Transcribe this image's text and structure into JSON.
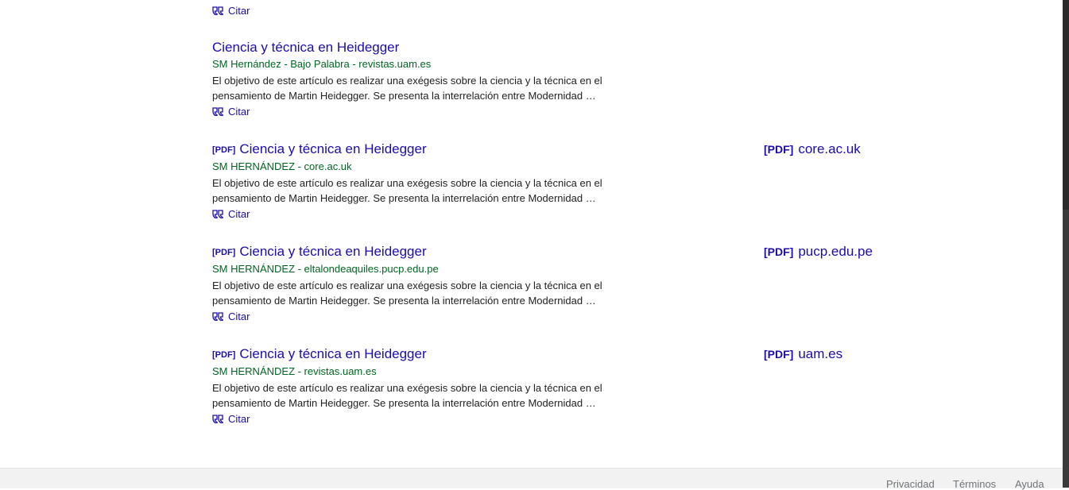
{
  "cite_label": "Citar",
  "top_cite": {
    "label": "Citar"
  },
  "results": [
    {
      "pdf_tag": "",
      "title": "Ciencia y técnica en Heidegger",
      "meta": "SM Hernández - Bajo Palabra - revistas.uam.es",
      "snippet_line1": "El objetivo de este artículo es realizar una exégesis sobre la ciencia y la técnica en el",
      "snippet_line2": "pensamiento de Martin Heidegger. Se presenta la interrelación entre Modernidad …",
      "cite": "Citar"
    },
    {
      "pdf_tag": "[PDF]",
      "title": "Ciencia y técnica en Heidegger",
      "meta": "SM HERNÁNDEZ - core.ac.uk",
      "snippet_line1": "El objetivo de este artículo es realizar una exégesis sobre la ciencia y la técnica en el",
      "snippet_line2": "pensamiento de Martin Heidegger. Se presenta la interrelación entre Modernidad …",
      "cite": "Citar",
      "side_tag": "[PDF]",
      "side_domain": "core.ac.uk"
    },
    {
      "pdf_tag": "[PDF]",
      "title": "Ciencia y técnica en Heidegger",
      "meta": "SM HERNÁNDEZ - eltalondeaquiles.pucp.edu.pe",
      "snippet_line1": "El objetivo de este artículo es realizar una exégesis sobre la ciencia y la técnica en el",
      "snippet_line2": "pensamiento de Martin Heidegger. Se presenta la interrelación entre Modernidad …",
      "cite": "Citar",
      "side_tag": "[PDF]",
      "side_domain": "pucp.edu.pe"
    },
    {
      "pdf_tag": "[PDF]",
      "title": "Ciencia y técnica en Heidegger",
      "meta": "SM HERNÁNDEZ - revistas.uam.es",
      "snippet_line1": "El objetivo de este artículo es realizar una exégesis sobre la ciencia y la técnica en el",
      "snippet_line2": "pensamiento de Martin Heidegger. Se presenta la interrelación entre Modernidad …",
      "cite": "Citar",
      "side_tag": "[PDF]",
      "side_domain": "uam.es"
    }
  ],
  "footer": {
    "privacy": "Privacidad",
    "terms": "Términos",
    "help": "Ayuda"
  },
  "colors": {
    "link": "#1a0dab",
    "meta_green": "#006621",
    "snippet": "#222222"
  }
}
